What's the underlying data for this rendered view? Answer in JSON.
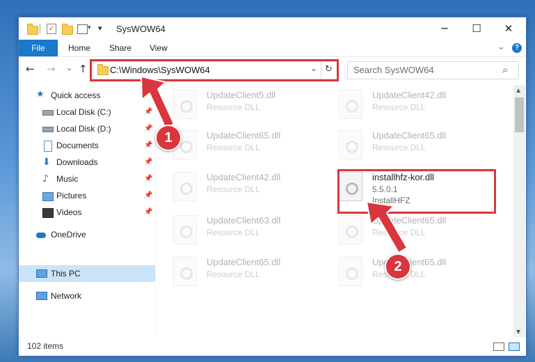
{
  "window": {
    "title": "SysWOW64",
    "controls": {
      "minimize": "─",
      "maximize": "☐",
      "close": "✕"
    }
  },
  "ribbon": {
    "tabs": [
      "File",
      "Home",
      "Share",
      "View"
    ],
    "help": "?",
    "expand": "⌄"
  },
  "nav": {
    "address": "C:\\Windows\\SysWOW64",
    "search_placeholder": "Search SysWOW64",
    "back": "←",
    "forward": "→",
    "recent": "⌄",
    "up": "↑",
    "addr_dropdown": "⌄",
    "refresh": "↻",
    "search_icon": "⌕"
  },
  "sidebar": {
    "quick_access": "Quick access",
    "items": [
      {
        "label": "Local Disk (C:)",
        "icon": "drive-icon"
      },
      {
        "label": "Local Disk (D:)",
        "icon": "drive-icon"
      },
      {
        "label": "Documents",
        "icon": "documents-icon"
      },
      {
        "label": "Downloads",
        "icon": "downloads-icon"
      },
      {
        "label": "Music",
        "icon": "music-icon"
      },
      {
        "label": "Pictures",
        "icon": "pictures-icon"
      },
      {
        "label": "Videos",
        "icon": "videos-icon"
      }
    ],
    "onedrive": "OneDrive",
    "this_pc": "This PC",
    "network": "Network",
    "pin": "📌"
  },
  "files": [
    {
      "name": "UpdateClient5.dll",
      "type": "Resource DLL"
    },
    {
      "name": "UpdateClient42.dll",
      "type": "Resource DLL"
    },
    {
      "name": "UpdateClient65.dll",
      "type": "Resource DLL"
    },
    {
      "name": "UpdateClient65.dll",
      "type": "Resource DLL"
    },
    {
      "name": "UpdateClient42.dll",
      "type": "Resource DLL"
    },
    {
      "name": "installhfz-kor.dll",
      "version": "5.5.0.1",
      "company": "InstallHFZ"
    },
    {
      "name": "UpdateClient63.dll",
      "type": "Resource DLL"
    },
    {
      "name": "UpdateClient65.dll",
      "type": "Resource DLL"
    },
    {
      "name": "UpdateClient65.dll",
      "type": "Resource DLL"
    },
    {
      "name": "UpdateClient65.dll",
      "type": "Resource DLL"
    }
  ],
  "status": {
    "count": "102 items"
  },
  "annotations": {
    "step1": "1",
    "step2": "2"
  },
  "colors": {
    "accent": "#1979ca",
    "highlight": "#d9363e",
    "selected": "#cce4f7"
  }
}
